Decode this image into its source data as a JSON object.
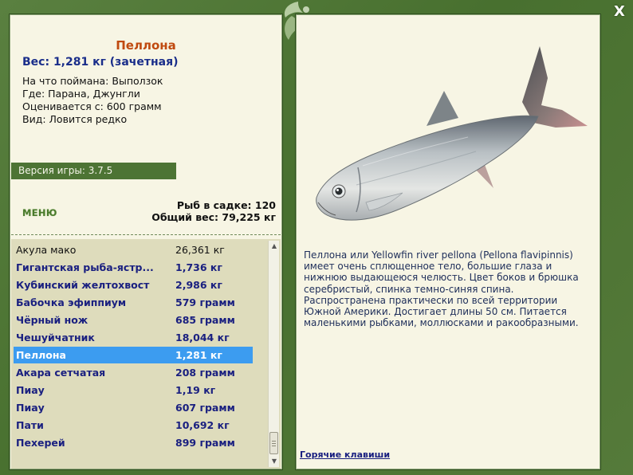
{
  "window": {
    "close_label": "X"
  },
  "fish": {
    "name": "Пеллона",
    "weight_line": "Вес: 1,281 кг (зачетная)",
    "info": [
      "На что поймана: Выползок",
      "Где: Парана, Джунгли",
      "Оценивается с: 600 грамм",
      "Вид: Ловится редко"
    ],
    "description": "Пеллона или Yellowfin river pellona (Pellona flavipinnis) имеет очень сплющенное тело, большие глаза и нижнюю выдающеюся челюсть. Цвет боков и брюшка серебристый, спинка темно-синяя спина. Распространена практически по всей территории Южной Америки. Достигает длины 50 см. Питается маленькими рыбками, моллюсками и ракообразными."
  },
  "version": "Версия игры: 3.7.5",
  "menu_label": "МЕНЮ",
  "stats": {
    "fish_count": "Рыб в садке: 120",
    "total_weight": "Общий вес: 79,225 кг"
  },
  "catch_list": [
    {
      "name": "Акула мако",
      "weight": "26,361 кг",
      "style": "normal"
    },
    {
      "name": "Гигантская рыба-ястр...",
      "weight": "1,736 кг",
      "style": "bold"
    },
    {
      "name": "Кубинский желтохвост",
      "weight": "2,986 кг",
      "style": "bold"
    },
    {
      "name": "Бабочка эфиппиум",
      "weight": "579 грамм",
      "style": "bold"
    },
    {
      "name": "Чёрный нож",
      "weight": "685 грамм",
      "style": "bold"
    },
    {
      "name": "Чешуйчатник",
      "weight": "18,044 кг",
      "style": "bold"
    },
    {
      "name": "Пеллона",
      "weight": "1,281 кг",
      "style": "selected"
    },
    {
      "name": "Акара сетчатая",
      "weight": "208 грамм",
      "style": "bold"
    },
    {
      "name": "Пиау",
      "weight": "1,19 кг",
      "style": "bold"
    },
    {
      "name": "Пиау",
      "weight": "607 грамм",
      "style": "bold"
    },
    {
      "name": "Пати",
      "weight": "10,692 кг",
      "style": "bold"
    },
    {
      "name": "Пехерей",
      "weight": "899 грамм",
      "style": "bold"
    }
  ],
  "hotkeys_label": "Горячие клавиши",
  "colors": {
    "frame_green": "#4e7434",
    "panel_bg": "#f7f5e4",
    "title_orange": "#c04a10",
    "navy_text": "#1a2080",
    "selection_blue": "#3c9cf0"
  }
}
